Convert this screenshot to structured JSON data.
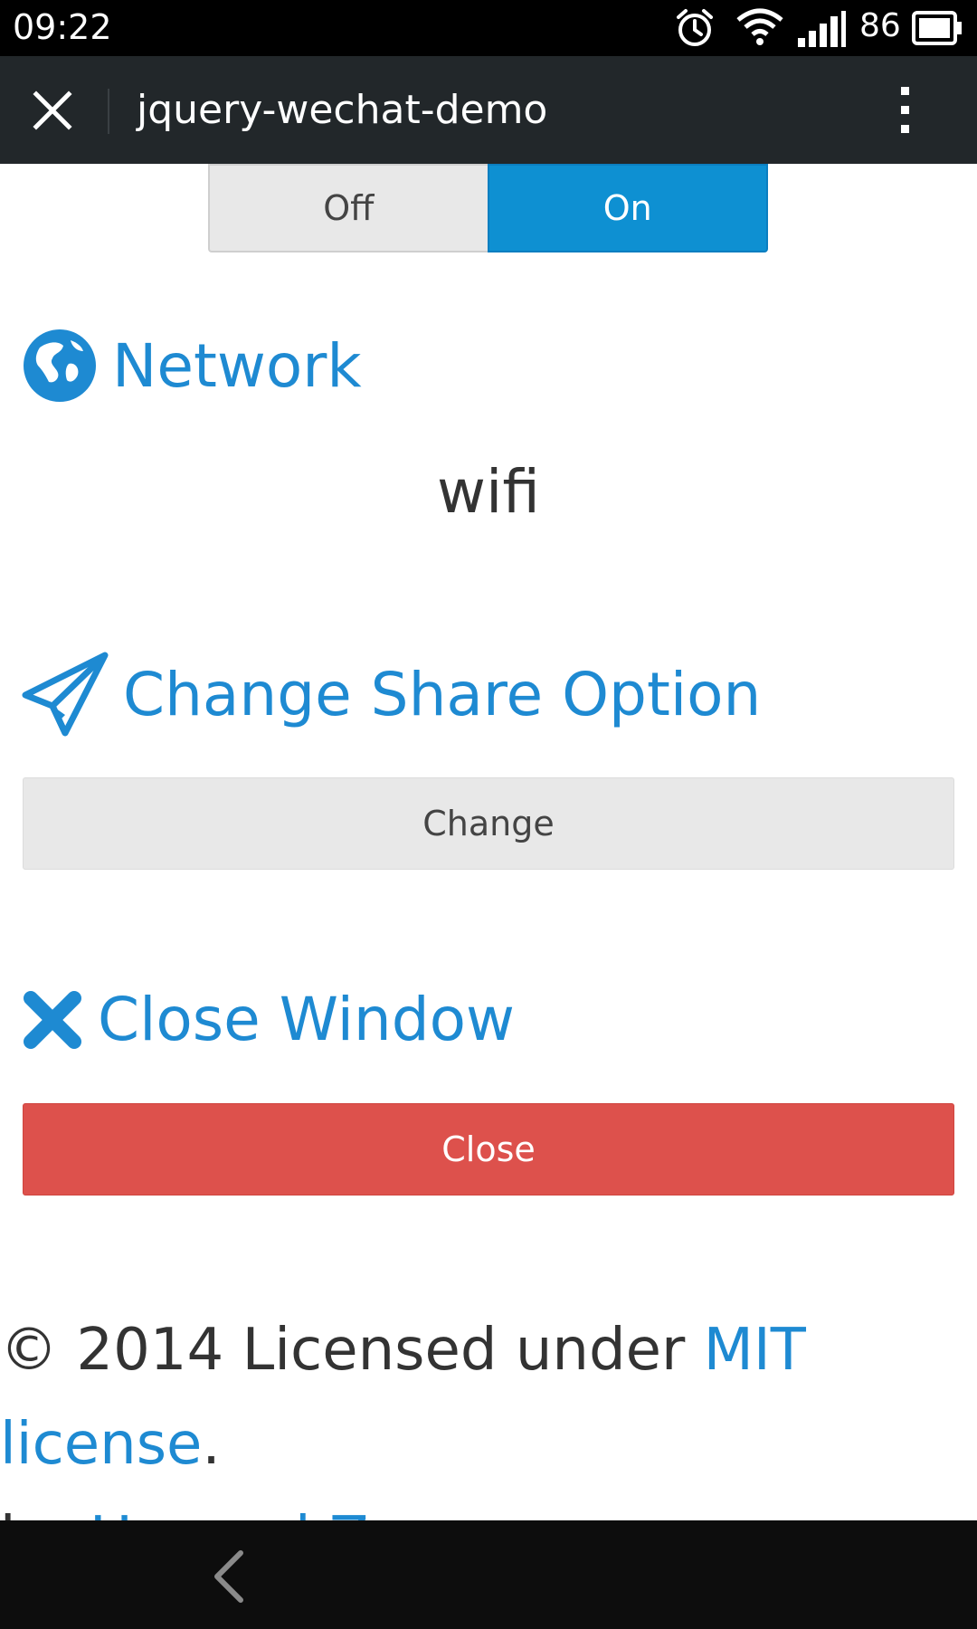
{
  "status_bar": {
    "time": "09:22",
    "battery": "86",
    "icons": [
      "alarm-icon",
      "wifi-icon",
      "signal-icon",
      "battery-icon"
    ]
  },
  "title_bar": {
    "title": "jquery-wechat-demo",
    "close_icon": "close-icon",
    "more_icon": "more-vertical-icon"
  },
  "segmented": {
    "off_label": "Off",
    "on_label": "On",
    "selected": "On"
  },
  "network": {
    "heading": "Network",
    "icon": "globe-icon",
    "value": "wifi"
  },
  "share": {
    "heading": "Change Share Option",
    "icon": "paper-plane-icon",
    "button_label": "Change"
  },
  "close_window": {
    "heading": "Close Window",
    "icon": "x-icon",
    "button_label": "Close"
  },
  "footer": {
    "line1_prefix": "© 2014 Licensed under ",
    "line1_link": "MIT license",
    "line1_suffix": ".",
    "line2_prefix": "by ",
    "line2_link": "Howard.Zuo",
    "line2_suffix": "."
  },
  "colors": {
    "accent": "#1e8ad2",
    "on_blue": "#0e90d2",
    "danger": "#dd514c",
    "titlebar": "#22272a"
  }
}
